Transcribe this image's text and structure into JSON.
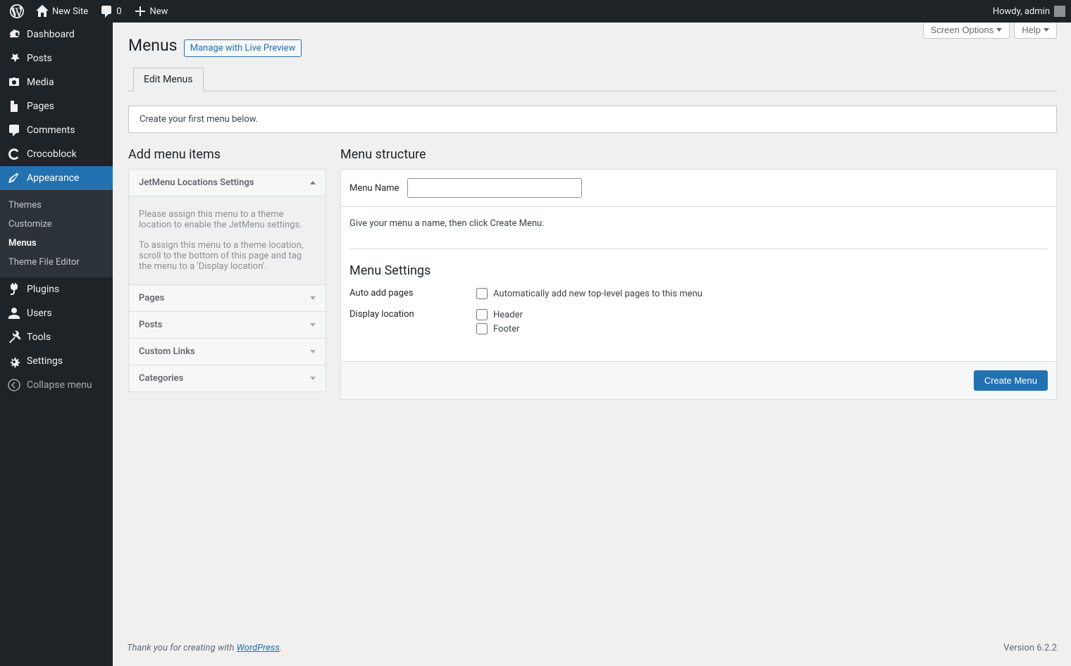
{
  "adminbar": {
    "site_name": "New Site",
    "comments_count": "0",
    "new_label": "New",
    "howdy": "Howdy, admin"
  },
  "sidebar": {
    "items": [
      {
        "icon": "dashboard",
        "label": "Dashboard"
      },
      {
        "icon": "pin",
        "label": "Posts"
      },
      {
        "icon": "media",
        "label": "Media"
      },
      {
        "icon": "pages",
        "label": "Pages"
      },
      {
        "icon": "comments",
        "label": "Comments"
      },
      {
        "icon": "croco",
        "label": "Crocoblock"
      },
      {
        "icon": "appearance",
        "label": "Appearance",
        "current": true
      },
      {
        "icon": "plugins",
        "label": "Plugins"
      },
      {
        "icon": "users",
        "label": "Users"
      },
      {
        "icon": "tools",
        "label": "Tools"
      },
      {
        "icon": "settings",
        "label": "Settings"
      },
      {
        "icon": "collapse",
        "label": "Collapse menu"
      }
    ],
    "submenu": [
      {
        "label": "Themes"
      },
      {
        "label": "Customize"
      },
      {
        "label": "Menus",
        "current": true
      },
      {
        "label": "Theme File Editor"
      }
    ]
  },
  "screen_meta": {
    "screen_options": "Screen Options",
    "help": "Help"
  },
  "page": {
    "title": "Menus",
    "action_button": "Manage with Live Preview",
    "tabs": [
      {
        "label": "Edit Menus",
        "active": true
      }
    ],
    "notice": "Create your first menu below."
  },
  "left_col": {
    "heading": "Add menu items",
    "expanded": {
      "title": "JetMenu Locations Settings",
      "p1": "Please assign this menu to a theme location to enable the JetMenu settings.",
      "p2": "To assign this menu to a theme location, scroll to the bottom of this page and tag the menu to a 'Display location'."
    },
    "panels": [
      "Pages",
      "Posts",
      "Custom Links",
      "Categories"
    ]
  },
  "right_col": {
    "heading": "Menu structure",
    "menu_name_label": "Menu Name",
    "menu_name_value": "",
    "hint": "Give your menu a name, then click Create Menu.",
    "settings_heading": "Menu Settings",
    "auto_add_label": "Auto add pages",
    "auto_add_opt": "Automatically add new top-level pages to this menu",
    "display_location_label": "Display location",
    "locations": [
      "Header",
      "Footer"
    ],
    "create_btn": "Create Menu"
  },
  "footer": {
    "thanks_prefix": "Thank you for creating with ",
    "thanks_link": "WordPress",
    "thanks_suffix": ".",
    "version": "Version 6.2.2"
  }
}
